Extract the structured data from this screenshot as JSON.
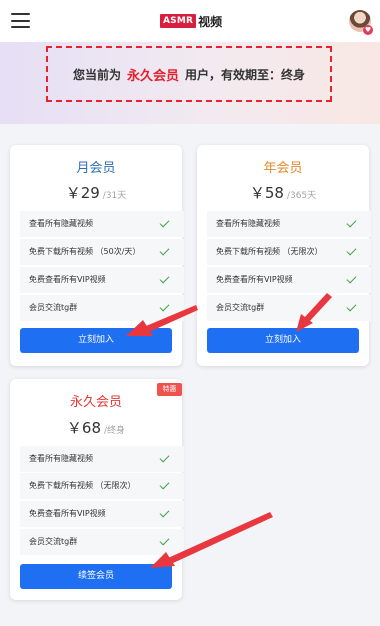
{
  "header": {
    "logo_badge": "ASMR",
    "logo_text": "视频",
    "menu_icon": "hamburger-menu-icon",
    "avatar_badge_icon": "heart-icon",
    "avatar_badge_glyph": "♥"
  },
  "notice": {
    "prefix": "您当前为",
    "tier": "永久会员",
    "suffix": "用户，有效期至：终身",
    "tier_color": "#e1232f"
  },
  "colors": {
    "button": "#1f6ff2",
    "check": "#43a047",
    "monthly_title": "#2f6db3",
    "yearly_title": "#e08a2c",
    "lifetime_title": "#e53935",
    "tag": "#ef5350"
  },
  "plans": [
    {
      "title": "月会员",
      "price": "￥29",
      "period": "/31天",
      "features": [
        "查看所有隐藏视频",
        "免费下载所有视频 （50次/天）",
        "免费查看所有VIP视频",
        "会员交流tg群"
      ],
      "button": "立刻加入"
    },
    {
      "title": "年会员",
      "price": "￥58",
      "period": "/365天",
      "features": [
        "查看所有隐藏视频",
        "免费下载所有视频 （无限次）",
        "免费查看所有VIP视频",
        "会员交流tg群"
      ],
      "button": "立刻加入"
    },
    {
      "title": "永久会员",
      "price": "￥68",
      "period": "/终身",
      "tag": "特惠",
      "features": [
        "查看所有隐藏视频",
        "免费下载所有视频 （无限次）",
        "免费查看所有VIP视频",
        "会员交流tg群"
      ],
      "button": "续签会员"
    }
  ]
}
